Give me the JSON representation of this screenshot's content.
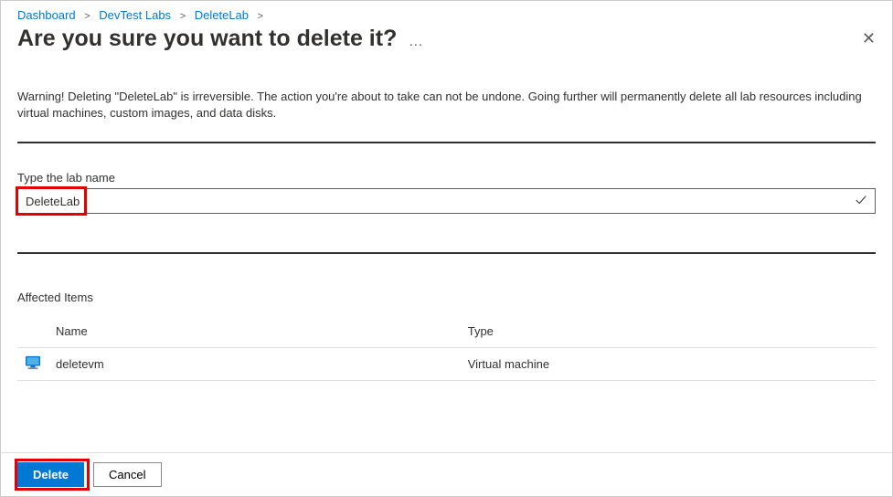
{
  "breadcrumb": {
    "items": [
      "Dashboard",
      "DevTest Labs",
      "DeleteLab"
    ]
  },
  "page": {
    "title": "Are you sure you want to delete it?"
  },
  "warning": "Warning! Deleting \"DeleteLab\" is irreversible. The action you're about to take can not be undone. Going further will permanently delete all lab resources including virtual machines, custom images, and data disks.",
  "form": {
    "labNameLabel": "Type the lab name",
    "labNameValue": "DeleteLab"
  },
  "affected": {
    "title": "Affected Items",
    "columns": {
      "name": "Name",
      "type": "Type"
    },
    "rows": [
      {
        "name": "deletevm",
        "type": "Virtual machine"
      }
    ]
  },
  "footer": {
    "deleteLabel": "Delete",
    "cancelLabel": "Cancel"
  }
}
